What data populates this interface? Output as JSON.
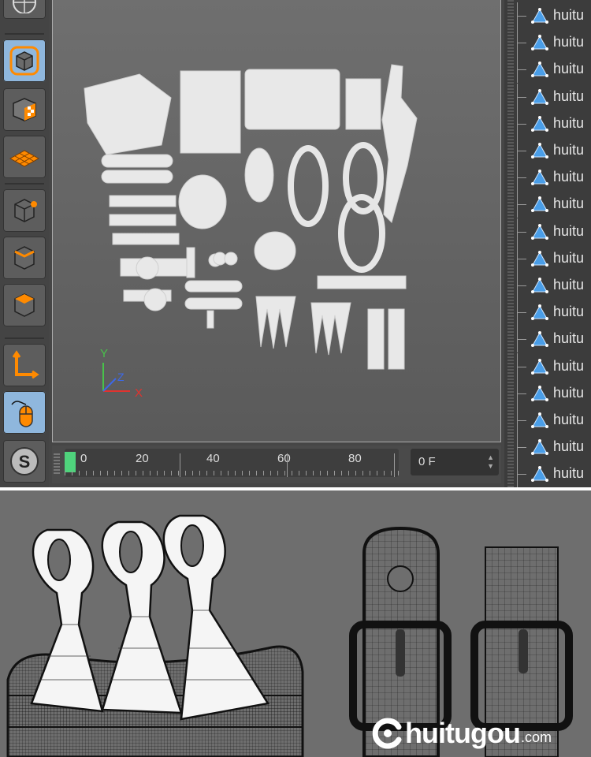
{
  "toolbar": {
    "tools": [
      {
        "name": "model-mode-icon",
        "active": true
      },
      {
        "name": "texture-mode-icon",
        "active": false
      },
      {
        "name": "workplane-mode-icon",
        "active": false
      },
      {
        "name": "points-mode-icon",
        "active": false
      },
      {
        "name": "edges-mode-icon",
        "active": false
      },
      {
        "name": "polygons-mode-icon",
        "active": false
      },
      {
        "name": "axis-mode-icon",
        "active": false
      },
      {
        "name": "tweak-mouse-icon",
        "active": true
      },
      {
        "name": "snap-s-icon",
        "active": false
      }
    ]
  },
  "viewport": {
    "axis_labels": {
      "y": "Y",
      "z": "Z",
      "x": "X"
    }
  },
  "timeline": {
    "ticks": [
      "0",
      "20",
      "40",
      "60",
      "80"
    ],
    "current_frame": "0 F"
  },
  "objects": {
    "items": [
      "huitu",
      "huitu",
      "huitu",
      "huitu",
      "huitu",
      "huitu",
      "huitu",
      "huitu",
      "huitu",
      "huitu",
      "huitu",
      "huitu",
      "huitu",
      "huitu",
      "huitu",
      "huitu",
      "huitu",
      "huitu"
    ]
  },
  "watermark": {
    "text": "huitugou",
    "domain": ".com"
  },
  "colors": {
    "accent": "#ff8a00",
    "active_tool": "#8fb7dd",
    "playhead": "#4fd37c",
    "object_icon": "#4a9ee8"
  }
}
